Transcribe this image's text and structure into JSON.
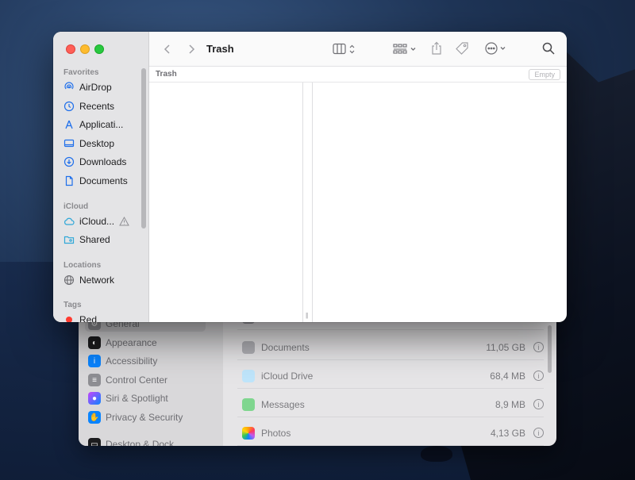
{
  "finder": {
    "title": "Trash",
    "path_label": "Trash",
    "empty_button": "Empty",
    "sidebar": {
      "favorites_header": "Favorites",
      "favorites": [
        {
          "label": "AirDrop",
          "icon": "airdrop-icon"
        },
        {
          "label": "Recents",
          "icon": "clock-icon"
        },
        {
          "label": "Applicati...",
          "icon": "applications-icon"
        },
        {
          "label": "Desktop",
          "icon": "desktop-icon"
        },
        {
          "label": "Downloads",
          "icon": "download-icon"
        },
        {
          "label": "Documents",
          "icon": "document-icon"
        }
      ],
      "icloud_header": "iCloud",
      "icloud": [
        {
          "label": "iCloud...",
          "icon": "cloud-icon",
          "warning": "warning-icon"
        },
        {
          "label": "Shared",
          "icon": "shared-folder-icon"
        }
      ],
      "locations_header": "Locations",
      "locations": [
        {
          "label": "Network",
          "icon": "globe-icon"
        }
      ],
      "tags_header": "Tags",
      "tags": [
        {
          "label": "Red",
          "color": "#ff3b30"
        }
      ]
    },
    "toolbar": {
      "back": "chevron-left-icon",
      "forward": "chevron-right-icon",
      "view": "column-view-icon",
      "group": "group-icon",
      "share": "share-icon",
      "tag": "tag-icon",
      "more": "ellipsis-icon",
      "search": "search-icon"
    }
  },
  "settings": {
    "sidebar": [
      {
        "label": "General",
        "color": "#8e8e93"
      },
      {
        "label": "Appearance",
        "color": "#1c1c1e"
      },
      {
        "label": "Accessibility",
        "color": "#0a84ff"
      },
      {
        "label": "Control Center",
        "color": "#8e8e93"
      },
      {
        "label": "Siri & Spotlight",
        "color": "#c644fc"
      },
      {
        "label": "Privacy & Security",
        "color": "#0a84ff"
      },
      {
        "label": "Desktop & Dock",
        "color": "#1c1c1e"
      }
    ],
    "storage": [
      {
        "name": "Documents",
        "size": "11,05 GB",
        "color": "#9a9aa0"
      },
      {
        "name": "iCloud Drive",
        "size": "68,4 MB",
        "color": "#5ac8fa"
      },
      {
        "name": "Messages",
        "size": "8,9 MB",
        "color": "#34c759"
      },
      {
        "name": "Photos",
        "size": "4,13 GB",
        "color": "#ff9f0a"
      }
    ]
  }
}
